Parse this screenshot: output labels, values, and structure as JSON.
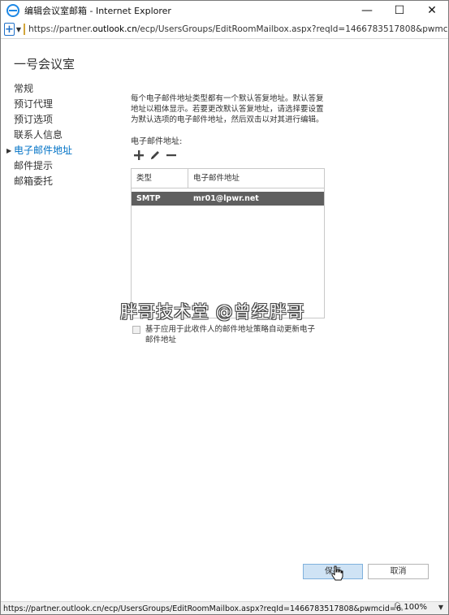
{
  "window": {
    "title": "编辑会议室邮箱 - Internet Explorer",
    "controls": {
      "minimize": "—",
      "maximize": "☐",
      "close": "✕"
    }
  },
  "address_bar": {
    "url_prefix": "https://partner.",
    "url_domain": "outlook.cn",
    "url_suffix": "/ecp/UsersGroups/EditRoomMailbox.aspx?reqId=1466783517808&pwmcid=6&Ret"
  },
  "page": {
    "title": "一号会议室"
  },
  "nav": {
    "items": [
      {
        "label": "常规",
        "active": false
      },
      {
        "label": "预订代理",
        "active": false
      },
      {
        "label": "预订选项",
        "active": false
      },
      {
        "label": "联系人信息",
        "active": false
      },
      {
        "label": "电子邮件地址",
        "active": true
      },
      {
        "label": "邮件提示",
        "active": false
      },
      {
        "label": "邮箱委托",
        "active": false
      }
    ]
  },
  "main": {
    "description": "每个电子邮件地址类型都有一个默认答复地址。默认答复地址以粗体显示。若要更改默认答复地址，请选择要设置为默认选项的电子邮件地址，然后双击以对其进行编辑。",
    "email_label": "电子邮件地址:",
    "toolbar": {
      "add_icon": "add-icon",
      "edit_icon": "pencil-icon",
      "remove_icon": "minus-icon"
    },
    "grid": {
      "headers": [
        "类型",
        "电子邮件地址"
      ],
      "rows": [
        {
          "type": "SMTP",
          "address": "mr01@lpwr.net"
        }
      ]
    },
    "auto_update_label": "基于应用于此收件人的邮件地址策略自动更新电子邮件地址",
    "watermark": "胖哥技术堂 @曾经胖哥"
  },
  "buttons": {
    "save": "保存",
    "cancel": "取消"
  },
  "status_bar": {
    "url": "https://partner.outlook.cn/ecp/UsersGroups/EditRoomMailbox.aspx?reqId=1466783517808&pwmcid=6",
    "zoom": "100%"
  }
}
